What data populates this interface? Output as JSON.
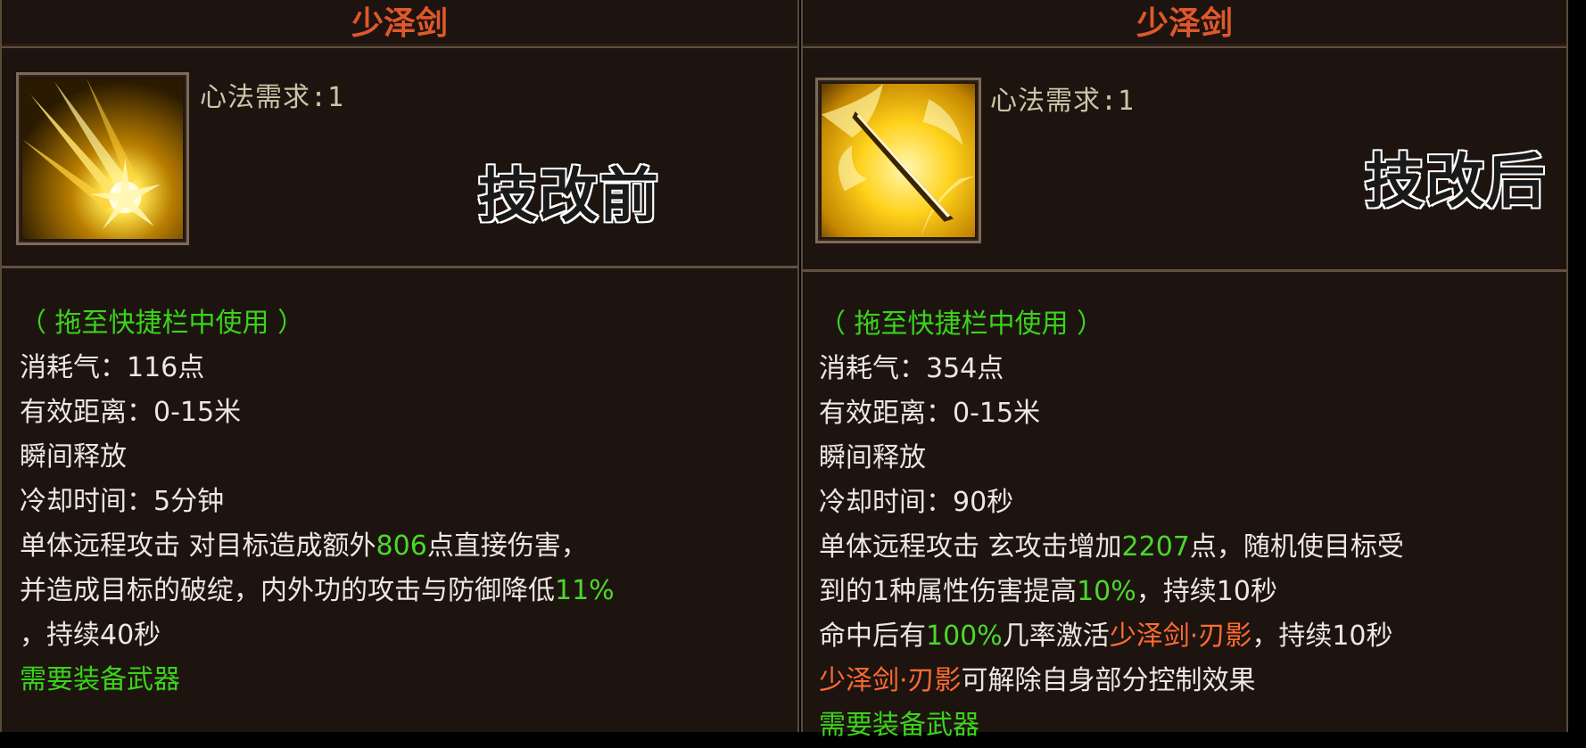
{
  "left": {
    "title": "少泽剑",
    "requirement": "心法需求:1",
    "tag": "技改前",
    "usage_hint": "（ 拖至快捷栏中使用 ）",
    "cost": "消耗气：116点",
    "range": "有效距离：0-15米",
    "cast": "瞬间释放",
    "cooldown": "冷却时间：5分钟",
    "desc1_a": "单体远程攻击 对目标造成额外",
    "desc1_num": "806",
    "desc1_b": "点直接伤害，",
    "desc2_a": "并造成目标的破绽，内外功的攻击与防御降低",
    "desc2_num": "11%",
    "desc3": "，持续40秒",
    "weapon_req": "需要装备武器"
  },
  "right": {
    "title": "少泽剑",
    "requirement": "心法需求:1",
    "tag": "技改后",
    "usage_hint": "（ 拖至快捷栏中使用 ）",
    "cost": "消耗气：354点",
    "range": "有效距离：0-15米",
    "cast": "瞬间释放",
    "cooldown": "冷却时间：90秒",
    "desc1_a": "单体远程攻击 玄攻击增加",
    "desc1_num": "2207",
    "desc1_b": "点，随机使目标受",
    "desc2_a": "到的1种属性伤害提高",
    "desc2_num": "10%",
    "desc2_b": "，持续10秒",
    "desc3_a": "命中后有",
    "desc3_num": "100%",
    "desc3_b": "几率激活",
    "desc3_skill": "少泽剑·刃影",
    "desc3_c": "，持续10秒",
    "desc4_skill": "少泽剑·刃影",
    "desc4_b": "可解除自身部分控制效果",
    "weapon_req": "需要装备武器"
  },
  "colors": {
    "title": "#e0582a",
    "hint_green": "#3bd31b",
    "number_green": "#4cd82a",
    "skill_orange": "#ff6b32",
    "text": "#ece8e0",
    "panel_bg": "#1d1410"
  },
  "icons": {
    "left": "fiery-sword-burst-icon",
    "right": "golden-blade-slash-icon"
  }
}
